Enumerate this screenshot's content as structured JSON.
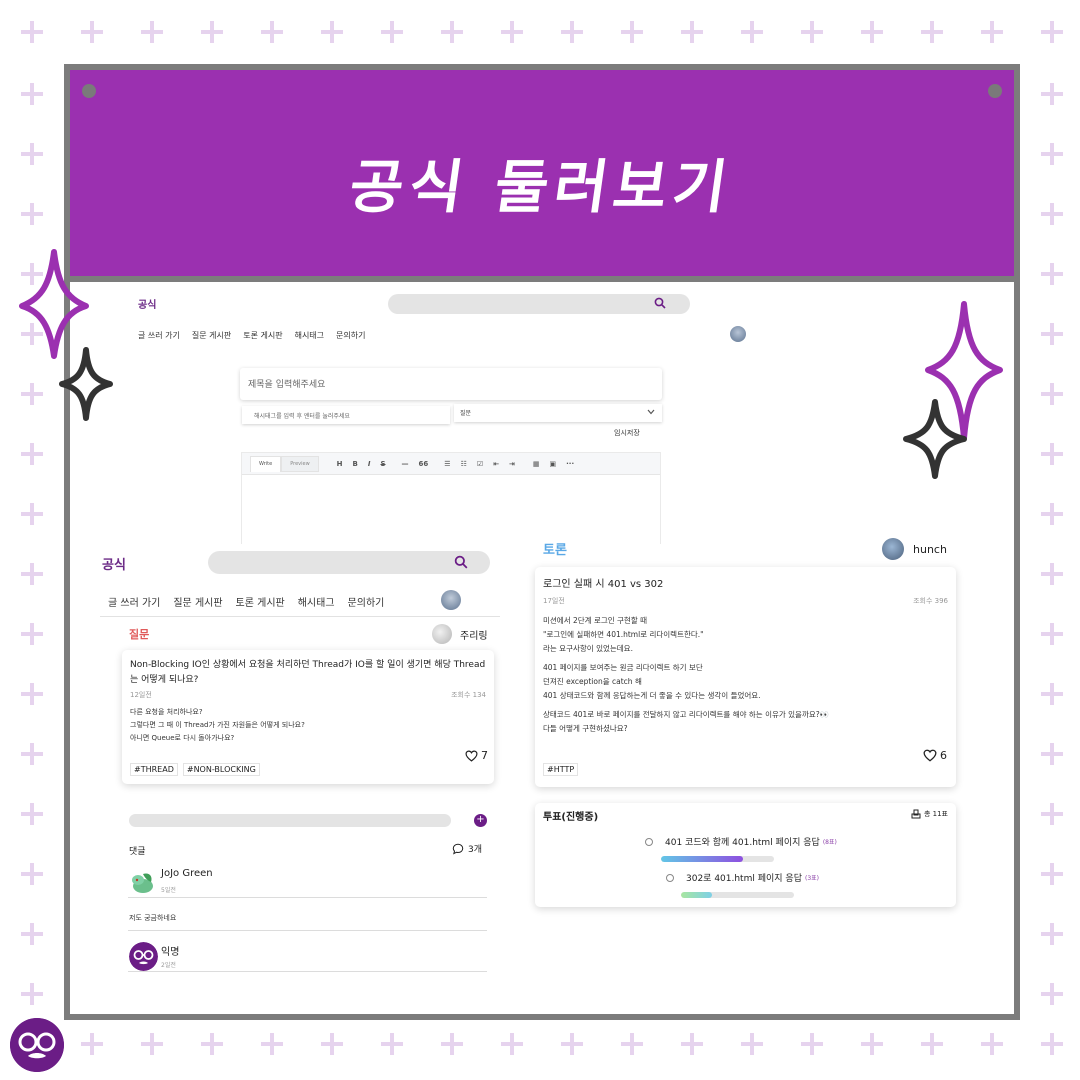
{
  "banner": {
    "title": "공식 둘러보기"
  },
  "colors": {
    "banner": "#9b30b0",
    "brand": "#6b2a86",
    "question_accent": "#e05a5a",
    "debate_accent": "#5aa8e6",
    "frame": "#7c7c7c",
    "cross": "#e6d3ee"
  },
  "editor_page": {
    "brand": "공식",
    "nav": [
      "글 쓰러 가기",
      "질문 게시판",
      "토론 게시판",
      "해시태그",
      "문의하기"
    ],
    "title_placeholder": "제목을 입력해주세요",
    "tag_placeholder": "해시태그를 입력 후 엔터를 눌러주세요",
    "select_value": "질문",
    "save_label": "임시저장",
    "editor_tabs": [
      "Write",
      "Preview"
    ],
    "toolbar": [
      "H",
      "B",
      "I",
      "S",
      "—",
      "66"
    ],
    "icons": [
      "search-icon",
      "chevron-down-icon"
    ]
  },
  "question_page": {
    "brand": "공식",
    "nav": [
      "글 쓰러 가기",
      "질문 게시판",
      "토론 게시판",
      "해시태그",
      "문의하기"
    ],
    "section": "질문",
    "author": "주리링",
    "post": {
      "title": "Non-Blocking IO인 상황에서 요청을 처리하던 Thread가 IO를 할 일이 생기면 해당 Thread는 어떻게 되나요?",
      "time": "12일전",
      "views": "조회수 134",
      "body": [
        "다른 요청을 처리하나요?",
        "그렇다면 그 때 이 Thread가 가진 자원들은 어떻게 되나요?",
        "아니면 Queue로 다시 돌아가나요?"
      ],
      "likes": "7",
      "tags": [
        "#THREAD",
        "#NON-BLOCKING"
      ]
    },
    "comments_label": "댓글",
    "comments_count": "3개",
    "comments": [
      {
        "name": "JoJo Green",
        "time": "5일전",
        "text": "저도 궁금하네요"
      },
      {
        "name": "익명",
        "time": "2일전"
      }
    ]
  },
  "debate_page": {
    "section": "토론",
    "author": "hunch",
    "post": {
      "title": "로그인 실패 시 401 vs 302",
      "time": "17일전",
      "views": "조회수 396",
      "paragraphs": [
        [
          "미션에서 2단계 로그인 구현할 때",
          "\"로그인에 실패하면 401.html로 리다이렉트한다.\"",
          "라는 요구사항이 있었는데요."
        ],
        [
          "401 페이지를 보여주는 원금 리다이렉트 하기 보단",
          "던져진 exception을 catch 해",
          "401 상태코드와 함께 응답하는게 더 좋을 수 있다는 생각이 들었어요."
        ],
        [
          "상태코드 401로 바로 페이지를 전달하지 않고 리다이렉트를 해야 하는 이유가 있을까요?👀",
          "다들 어떻게 구현하셨나요?"
        ]
      ],
      "likes": "6",
      "tags": [
        "#HTTP"
      ]
    },
    "vote": {
      "title": "투표(진행중)",
      "total": "총 11표",
      "options": [
        {
          "label": "401 코드와 함께 401.html 페이지 응답",
          "count": "(8표)",
          "fraction": 0.73
        },
        {
          "label": "302로 401.html 페이지 응답",
          "count": "(3표)",
          "fraction": 0.27
        }
      ]
    }
  }
}
